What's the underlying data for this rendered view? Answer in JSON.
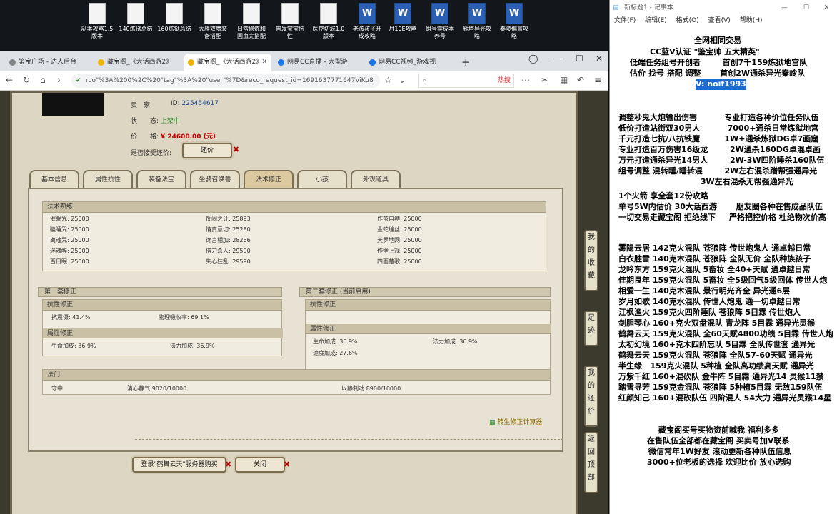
{
  "desktop": {
    "icons": [
      {
        "label": "副本攻略1.5\n版本",
        "type": "doc"
      },
      {
        "label": "140炼狱总结",
        "type": "doc"
      },
      {
        "label": "160炼狱总结",
        "type": "doc"
      },
      {
        "label": "大雁双魔装\n备搭配",
        "type": "doc"
      },
      {
        "label": "日常修炼和\n国血完搭配",
        "type": "doc"
      },
      {
        "label": "普发宝宝抗\n性",
        "type": "doc"
      },
      {
        "label": "医疗切城1.0\n版本",
        "type": "doc"
      },
      {
        "label": "老孩孩子开\n成攻略",
        "type": "word"
      },
      {
        "label": "月10E攻略",
        "type": "word"
      },
      {
        "label": "组号零成本\n养号",
        "type": "word"
      },
      {
        "label": "雁塔异光攻\n略",
        "type": "word"
      },
      {
        "label": "秦陵偏盲攻\n略",
        "type": "word"
      }
    ]
  },
  "browser": {
    "tabs": [
      {
        "label": "鉴宝广场 - 达人后台",
        "color": "#888"
      },
      {
        "label": "藏宝阁_《大话西游2》",
        "color": "#f0b400"
      },
      {
        "label": "藏宝阁_《大话西游2》",
        "color": "#f0b400"
      },
      {
        "label": "网易CC直播 - 大型游",
        "color": "#1a73e8"
      },
      {
        "label": "网易CC视频_游戏视",
        "color": "#1a73e8"
      }
    ],
    "url": "rco\"%3A%200%2C%20\"tag\"%3A%20\"user\"%7D&reco_request_id=1691637771647ViKu8",
    "search_hot": "热搜"
  },
  "listing": {
    "seller_label": "卖　家",
    "id_label": "ID:",
    "id_value": "225454617",
    "status_label": "状　　态:",
    "status_value": "上架中",
    "price_label": "价　　格:",
    "price_value": "¥ 24600.00 (元)",
    "bargain_label": "是否接受还价:",
    "bargain_button": "还价"
  },
  "tabs": [
    "基本信息",
    "属性抗性",
    "装备法宝",
    "坐骑召唤兽",
    "法术修正",
    "小孩",
    "外观道具"
  ],
  "active_tab": "法术修正",
  "spells": {
    "title": "法术熟练",
    "rows": [
      [
        "催眠咒: 25000",
        "反间之计: 25893",
        "作茧自缚: 25000"
      ],
      [
        "瞌睡咒: 25000",
        "情真意切: 25280",
        "金蛇缠丝: 25000"
      ],
      [
        "离魂咒: 25000",
        "谗言相加: 28266",
        "天罗地网: 25000"
      ],
      [
        "迷魂醉: 25000",
        "借刀杀人: 29590",
        "作壁上观: 25000"
      ],
      [
        "百日眠: 25000",
        "失心狂乱: 29590",
        "四面楚歌: 25000"
      ]
    ]
  },
  "set1": {
    "title": "第一套修正",
    "resist_title": "抗性修正",
    "resist": [
      "抗震慑: 41.4%",
      "物理吸收率: 69.1%"
    ],
    "attr_title": "属性修正",
    "attr": [
      "生命加成: 36.9%",
      "法力加成: 36.9%"
    ]
  },
  "set2": {
    "title": "第二套修正 (当前启用)",
    "resist_title": "抗性修正",
    "attr_title": "属性修正",
    "attr": [
      "生命加成: 36.9%",
      "法力加成: 36.9%",
      "速度加成: 27.6%"
    ]
  },
  "fameng": {
    "title": "法门",
    "items": [
      "守中",
      "清心静气:9020/10000",
      "以静制动:8900/10000"
    ]
  },
  "calc_link": "转生修正计算器",
  "bottom": {
    "login_button": "登录\"鹤舞云天\"服务器购买",
    "close_button": "关闭"
  },
  "side_buttons": [
    "我的收藏",
    "足迹",
    "我的还价",
    "返回顶部"
  ],
  "notepad": {
    "title": "新标题1 - 记事本",
    "menu": [
      "文件(F)",
      "编辑(E)",
      "格式(O)",
      "查看(V)",
      "帮助(H)"
    ],
    "lines": [
      "全网相同交易",
      "CC蓝V认证 \"鉴宝帅 五大精英\"",
      "低端任务组号开创者        首创7千159炼狱地宫队",
      "估价 找号 搭配 调整       首创2W通杀异光秦岭队",
      "V: noif1993",
      "",
      "调整秒鬼大炮输出伤害          专业打造各种价位任务队伍",
      "低价打造站街双30男人          7000+通杀日常炼狱地宫",
      "千元打造七抗/八抗铁魔         1W+通杀炼狱DG卓7画窟",
      "专业打造百万伤害16级龙        2W通杀160DG卓混卓画",
      "万元打造通杀异光14男人        2W-3W四阶睡杀160队伍",
      "组号调整 混转睡/睡转混        2W左右混杀蹭帮强通异光",
      "                              3W左右混杀无帮强通异光",
      "1个火箭 享全套12份攻略",
      "单号5W内估价 30大话西游       朋友圈各种在售成品队伍",
      "一切交易走藏宝阁 拒绝线下     严格把控价格 杜绝物次价高",
      "",
      "雾隐云居 142克火混队 苍狼阵 传世炮鬼人 通卓越日常",
      "白衣胜雪 140克木混队 苍狼阵 全队无价 全队种族孩子",
      "龙吟东方 159克火混队 5畜妆 全40+天赋 通卓越日常",
      "佳期良年 159克火混队 5畜妆 全5级回气5级回体 传世人炮",
      "相爱一生 140克木混队 景行明光齐全 异光通6层",
      "岁月如歌 140克水混队 传世人炮鬼 通一切卓越日常",
      "江枫渔火 159克火四阶睡队 苍狼阵 5目霖 传世炮人",
      "剑胆琴心 160+克火双盘混队 青龙阵 5目霖 通异光灵猴",
      "鹤舞云天 159克火混队 全60天赋4800功绩 5目霖 传世人炮",
      "太初幻境 160+克木四阶忘队 5目霖 全队传世套 通异光",
      "鹤舞云天 159克火混队 苍狼阵 全队57-60天赋 通异光",
      "半生缘   159克火混队 5种植 全队高功绩高天赋 通异光",
      "万紫千红 160+混砍队 金牛阵 5目霖 通异光14 灵猴11禁",
      "踏雪寻芳 159克金混队 苍狼阵 5种植5目霖 无敌159队伍",
      "红颜知己 160+混砍队伍 四阶混人 54大力 通异光灵猴14星",
      "",
      "藏宝阁买号买物资前喊我 福利多多",
      "在售队伍全部都在藏宝阁 买卖号加V联系",
      "微信常年1W好友 滚动更新各种队伍信息",
      "3000+位老板的选择 欢迎比价 放心选购"
    ]
  }
}
